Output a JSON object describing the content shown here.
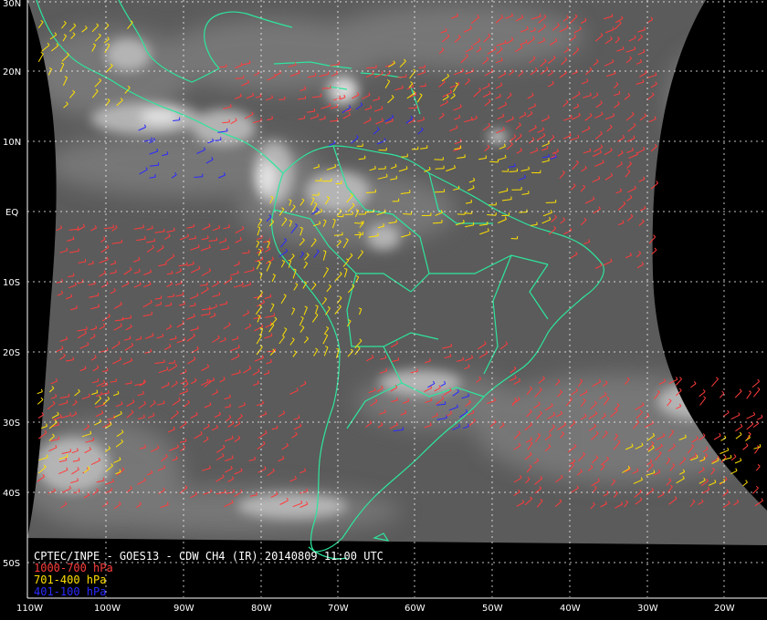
{
  "caption": {
    "title": "CPTEC/INPE - GOES13 - CDW CH4 (IR) 20140809 11:00 UTC"
  },
  "legend": [
    {
      "label": "1000-700 hPa",
      "color": "#ff3b3b"
    },
    {
      "label": "701-400 hPa",
      "color": "#ffe000"
    },
    {
      "label": "401-100 hPa",
      "color": "#2a2aff"
    }
  ],
  "latitude_labels": [
    "30N",
    "20N",
    "10N",
    "EQ",
    "10S",
    "20S",
    "30S",
    "40S",
    "50S"
  ],
  "longitude_labels": [
    "110W",
    "100W",
    "90W",
    "80W",
    "70W",
    "60W",
    "50W",
    "40W",
    "30W",
    "20W"
  ],
  "colors": {
    "background": "#000000",
    "satellite_gray": "#5a5a5a",
    "coastline": "#2ee59d",
    "gridline": "#ffffff"
  }
}
